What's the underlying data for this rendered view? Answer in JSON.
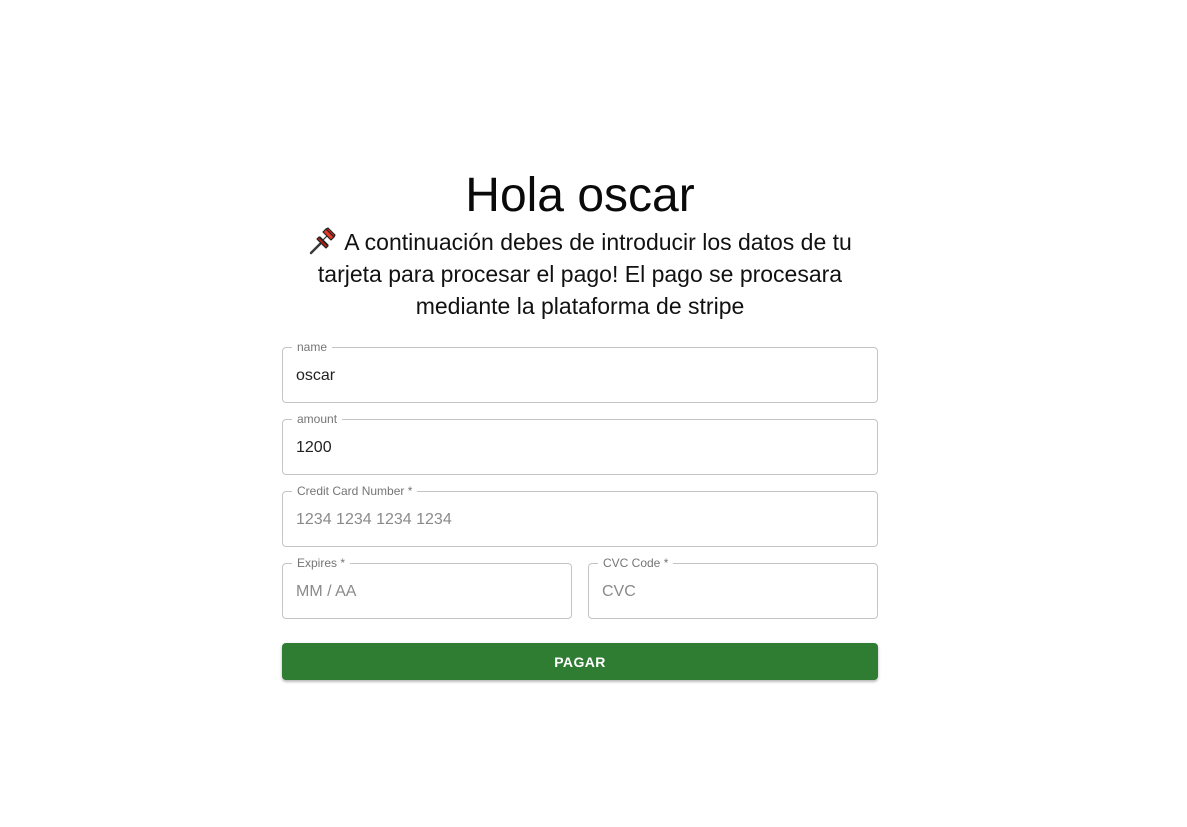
{
  "header": {
    "title": "Hola oscar",
    "message_icon": "pushpin-icon",
    "message": "A continuación debes de introducir los datos de tu tarjeta para procesar el pago! El pago se procesara mediante la plataforma de stripe"
  },
  "form": {
    "name": {
      "label": "name",
      "value": "oscar"
    },
    "amount": {
      "label": "amount",
      "value": "1200"
    },
    "card_number": {
      "label": "Credit Card Number *",
      "placeholder": "1234 1234 1234 1234"
    },
    "expires": {
      "label": "Expires *",
      "placeholder": "MM / AA"
    },
    "cvc": {
      "label": "CVC Code *",
      "placeholder": "CVC"
    },
    "submit_label": "PAGAR"
  },
  "colors": {
    "button": "#2e7d32",
    "border": "#c4c4c4",
    "label": "#757575"
  }
}
